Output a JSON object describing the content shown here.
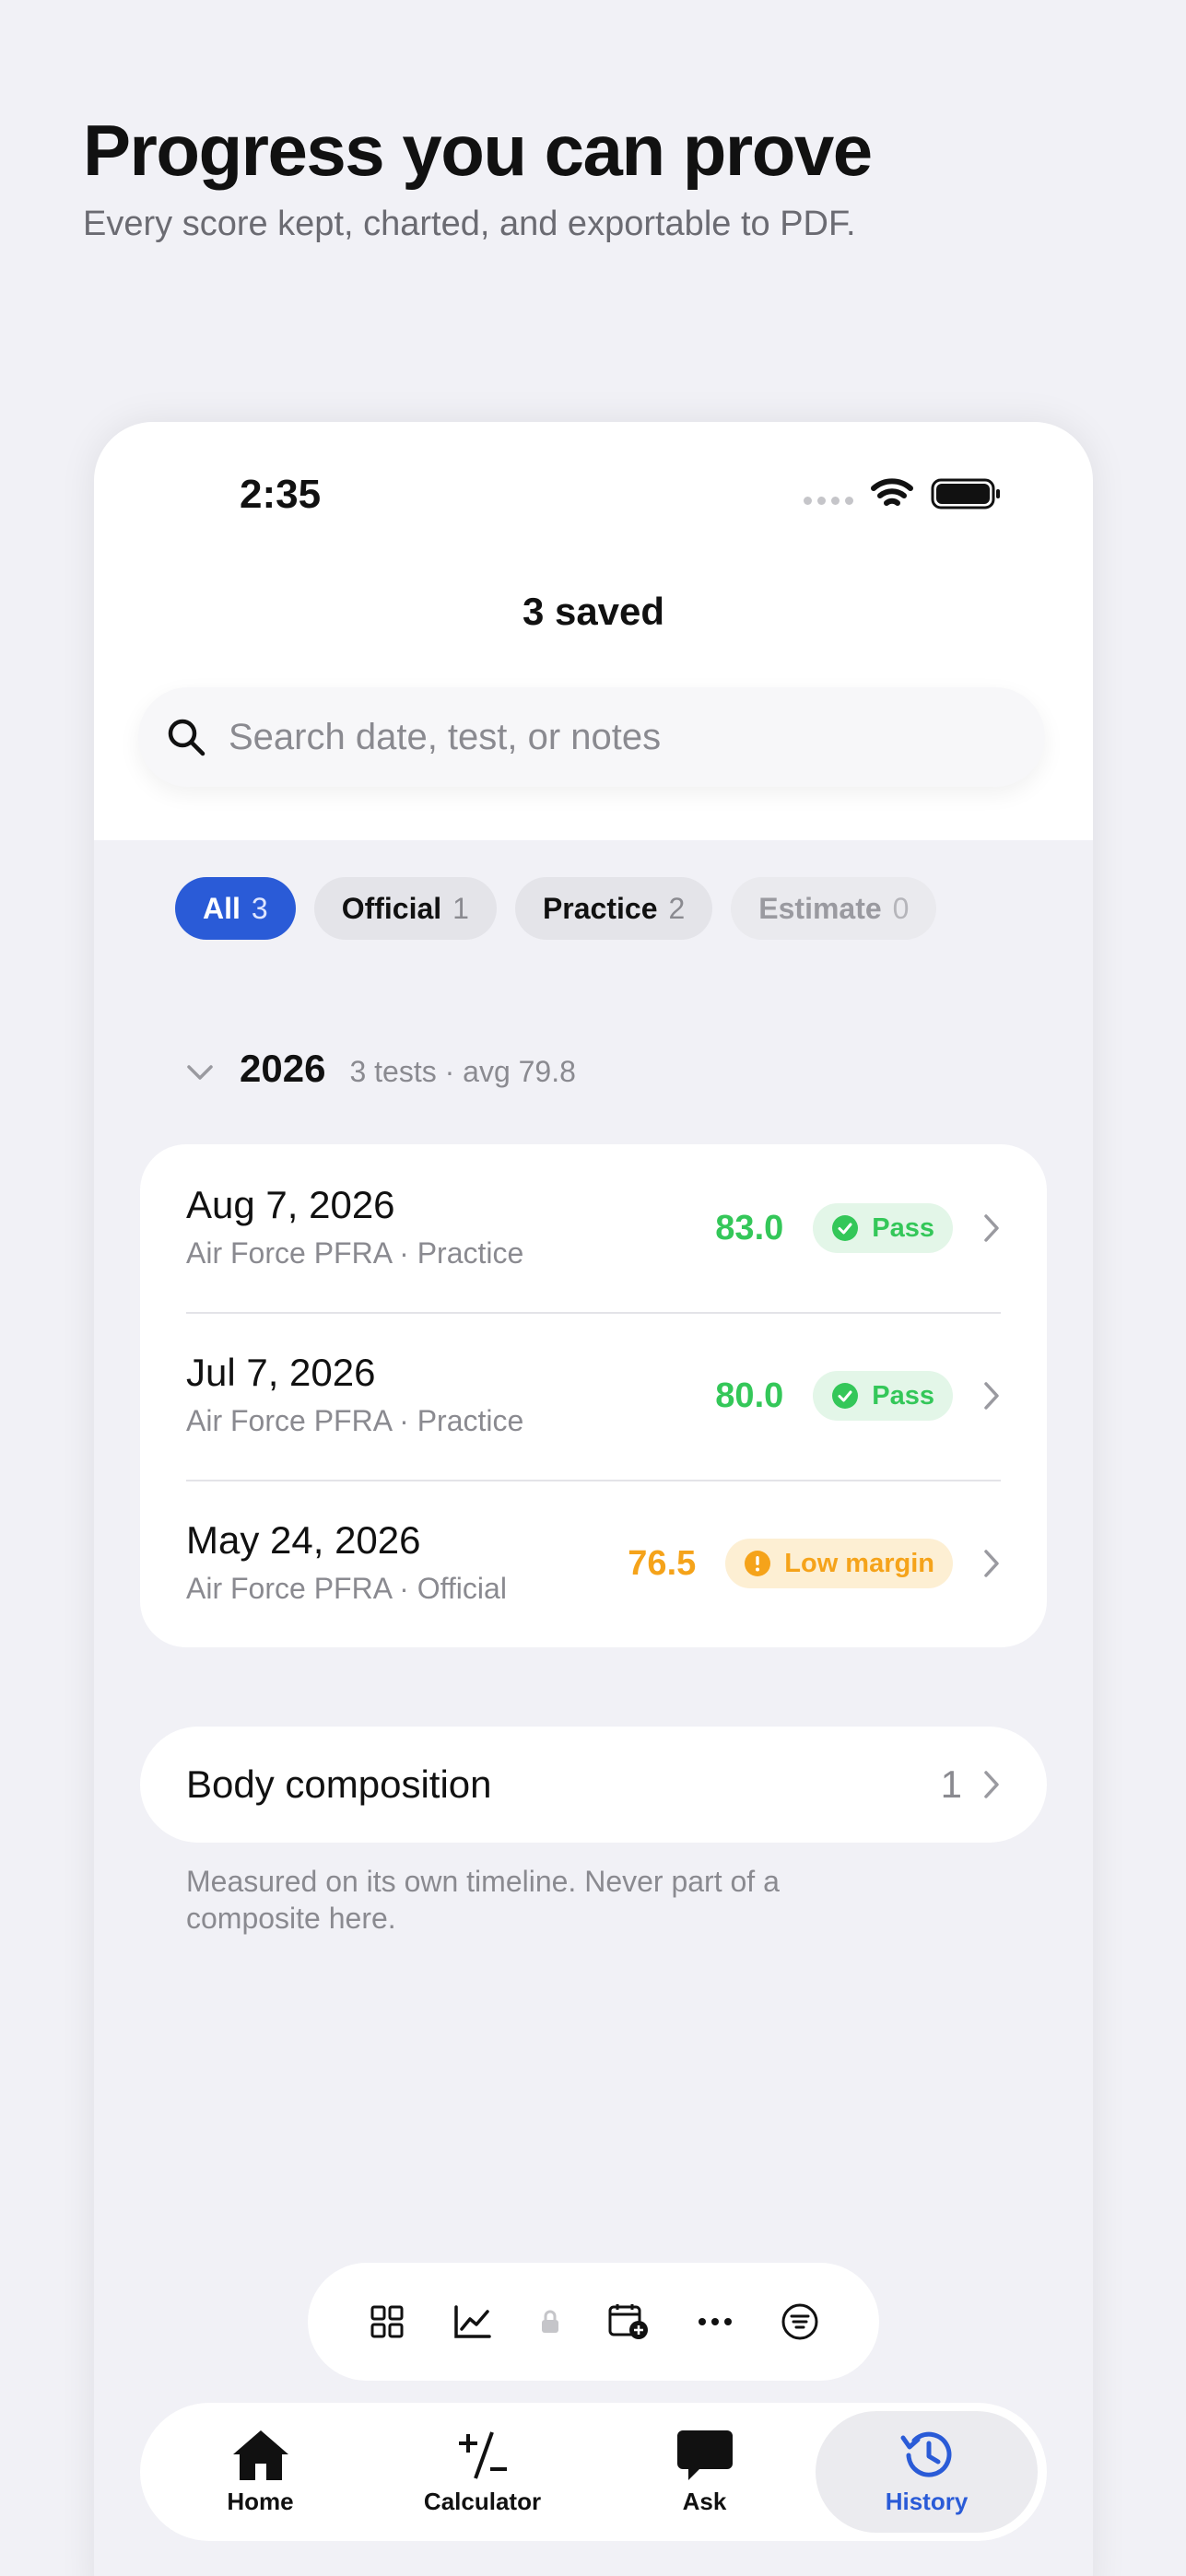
{
  "hero": {
    "title": "Progress you can prove",
    "subtitle": "Every score kept, charted, and exportable to PDF."
  },
  "status_bar": {
    "time": "2:35"
  },
  "nav": {
    "title": "3 saved"
  },
  "search": {
    "placeholder": "Search date, test, or notes"
  },
  "filters": [
    {
      "label": "All",
      "count": "3",
      "state": "selected"
    },
    {
      "label": "Official",
      "count": "1",
      "state": "normal"
    },
    {
      "label": "Practice",
      "count": "2",
      "state": "normal"
    },
    {
      "label": "Estimate",
      "count": "0",
      "state": "disabled"
    }
  ],
  "group": {
    "year": "2026",
    "meta": "3 tests · avg 79.8"
  },
  "records": [
    {
      "date": "Aug 7, 2026",
      "detail": "Air Force PFRA · Practice",
      "score": "83.0",
      "status": "Pass",
      "status_color": "#34c759"
    },
    {
      "date": "Jul 7, 2026",
      "detail": "Air Force PFRA · Practice",
      "score": "80.0",
      "status": "Pass",
      "status_color": "#34c759"
    },
    {
      "date": "May 24, 2026",
      "detail": "Air Force PFRA · Official",
      "score": "76.5",
      "status": "Low margin",
      "status_color": "#f5a31a"
    }
  ],
  "body_composition": {
    "label": "Body composition",
    "count": "1",
    "note": "Measured on its own timeline. Never part of a composite here."
  },
  "toolbar": [
    "grid-icon",
    "trend-chart-icon",
    "lock-icon",
    "calendar-add-icon",
    "more-icon",
    "filter-icon"
  ],
  "tabs": [
    {
      "label": "Home",
      "icon": "home-icon"
    },
    {
      "label": "Calculator",
      "icon": "calculator-icon"
    },
    {
      "label": "Ask",
      "icon": "chat-bubble-icon"
    },
    {
      "label": "History",
      "icon": "history-icon",
      "active": true
    }
  ],
  "colors": {
    "accent": "#2a5bd7",
    "pass": "#34c759",
    "warning": "#f5a31a",
    "background": "#f1f1f6"
  }
}
